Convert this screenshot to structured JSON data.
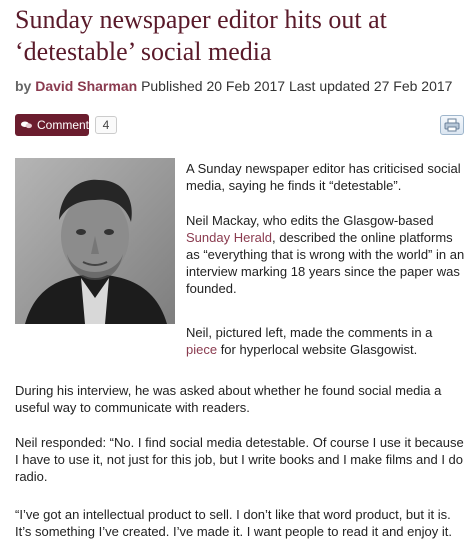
{
  "article": {
    "headline": "Sunday newspaper editor hits out at ‘detestable’ social media",
    "byline": {
      "by": "by",
      "author": "David Sharman",
      "published_label": "Published",
      "published_date": "20 Feb 2017",
      "updated_label": "Last updated",
      "updated_date": "27 Feb 2017"
    },
    "toolbar": {
      "comment_label": "Comment",
      "comment_count": "4",
      "print_icon": "print-icon"
    },
    "paragraphs": {
      "p1": "A Sunday newspaper editor has criticised social media, saying he finds it “detestable”.",
      "p2_a": "Neil Mackay, who edits the Glasgow-based ",
      "p2_link": "Sunday Herald",
      "p2_b": ", described the online platforms as “everything that is wrong with the world” in an interview marking 18 years since the paper was founded.",
      "p3_a": "Neil, pictured left, made the comments in a ",
      "p3_link": "piece",
      "p3_b": " for hyperlocal website Glasgowist.",
      "p4": "During his interview, he was asked about whether he found social media a useful way to communicate with readers.",
      "p5": "Neil responded: “No. I find social media detestable. Of course I use it because I have to use it, not just for this job, but I write books and I make films and I do radio.",
      "p6": "“I’ve got an intellectual product to sell. I don’t like that word product, but it is. It’s something I’ve created. I’ve made it. I want people to read it and enjoy it."
    }
  },
  "colors": {
    "headline": "#5a1a2a",
    "link": "#8a3b4f",
    "comment_button": "#6b1d2e"
  }
}
